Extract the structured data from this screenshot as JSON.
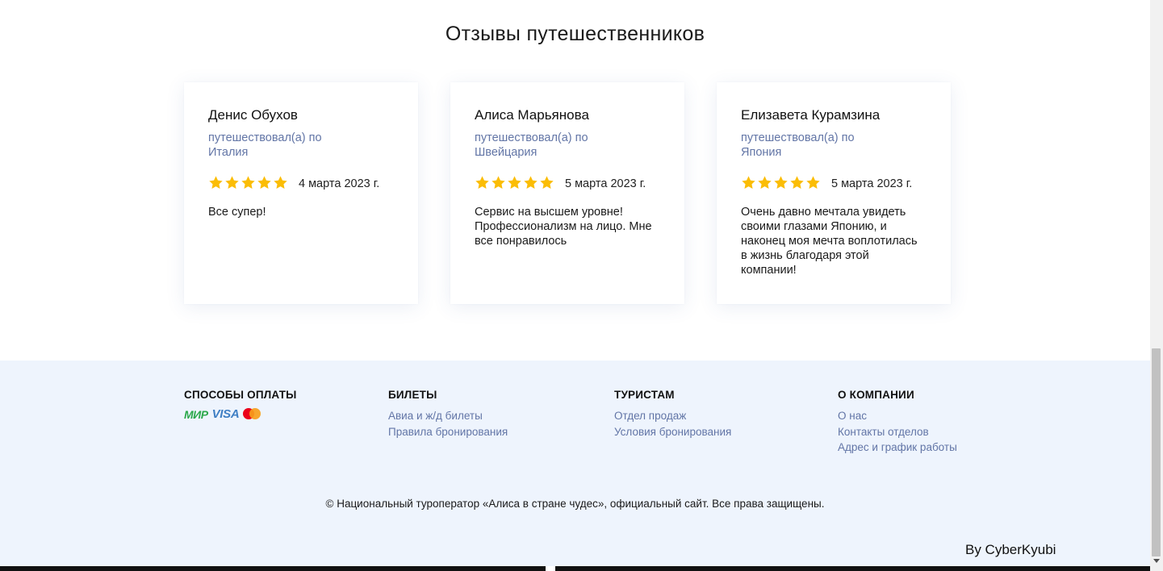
{
  "reviews_section": {
    "title": "Отзывы путешественников",
    "reviews": [
      {
        "name": "Денис Обухов",
        "trip_prefix": "путешествовал(а) по",
        "country": "Италия",
        "rating": 5,
        "date": "4 марта 2023 г.",
        "text": "Все супер!"
      },
      {
        "name": "Алиса Марьянова",
        "trip_prefix": "путешествовал(а) по",
        "country": "Швейцария",
        "rating": 5,
        "date": "5 марта 2023 г.",
        "text": "Сервис на высшем уровне! Профессионализм на лицо. Мне все понравилось"
      },
      {
        "name": "Елизавета Курамзина",
        "trip_prefix": "путешествовал(а) по",
        "country": "Япония",
        "rating": 5,
        "date": "5 марта 2023 г.",
        "text": "Очень давно мечтала увидеть своими глазами Японию, и наконец моя мечта воплотилась в жизнь благодаря этой компании!"
      }
    ]
  },
  "footer": {
    "payment": {
      "heading": "СПОСОБЫ ОПЛАТЫ",
      "logos": {
        "mir": "МИР",
        "visa": "VISA",
        "mastercard_icon": "mastercard-icon"
      }
    },
    "tickets": {
      "heading": "БИЛЕТЫ",
      "links": [
        "Авиа и ж/д билеты",
        "Правила бронирования"
      ]
    },
    "tourists": {
      "heading": "ТУРИСТАМ",
      "links": [
        "Отдел продаж",
        "Условия бронирования"
      ]
    },
    "company": {
      "heading": "О КОМПАНИИ",
      "links": [
        "О нас",
        "Контакты отделов",
        "Адрес и график работы"
      ]
    },
    "copyright": "© Национальный туроператор «Алиса в стране чудес», официальный сайт. Все права защищены.",
    "byline": "By CyberKyubi"
  },
  "colors": {
    "accent_text": "#6275a6",
    "star": "#fbbd05",
    "footer_bg": "#eef4fd",
    "mir_green": "#2ba84a",
    "visa_blue": "#3f7fc4",
    "mc_red": "#eb001b",
    "mc_orange": "#f79e1b"
  }
}
